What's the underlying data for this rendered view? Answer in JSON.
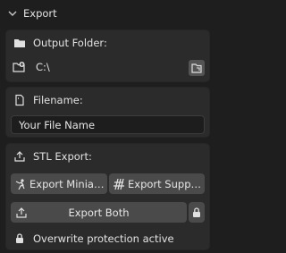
{
  "panel": {
    "title": "Export",
    "icon": "chevron-down-icon"
  },
  "output": {
    "label": "Output Folder:",
    "label_icon": "folder-icon",
    "path": "C:\\",
    "path_icon": "folder-add-icon",
    "browse_icon": "file-browser-icon"
  },
  "filename": {
    "label": "Filename:",
    "label_icon": "document-icon",
    "value": "Your File Name"
  },
  "stl": {
    "label": "STL Export:",
    "label_icon": "export-icon",
    "export_miniature_label": "Export Miniat...",
    "export_miniature_icon": "figure-icon",
    "export_supports_label": "Export Supports",
    "export_supports_icon": "supports-icon",
    "export_both_label": "Export Both",
    "export_both_icon": "export-icon",
    "lock_icon": "lock-icon",
    "protection_text": "Overwrite protection active"
  }
}
